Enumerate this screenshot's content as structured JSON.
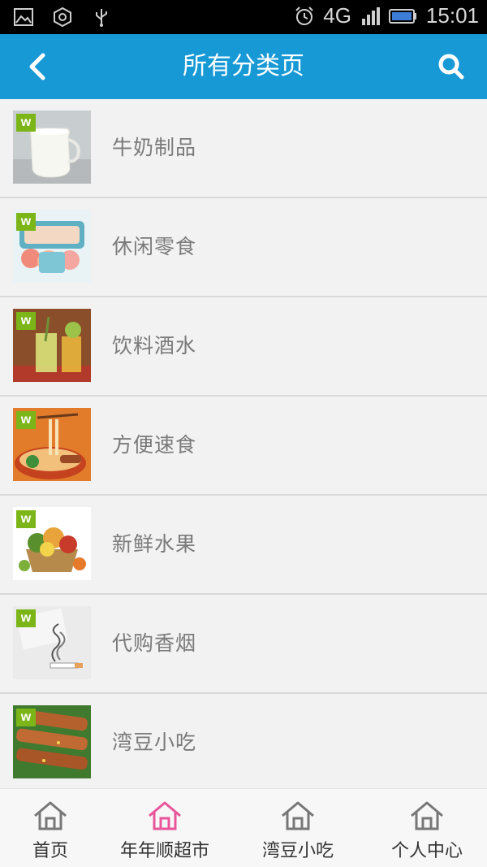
{
  "status_bar": {
    "network": "4G",
    "time": "15:01",
    "icons": [
      "image-icon",
      "settings-target-icon",
      "usb-icon",
      "alarm-icon",
      "signal-icon",
      "battery-icon"
    ]
  },
  "header": {
    "title": "所有分类页",
    "back_icon": "chevron-left-icon",
    "search_icon": "search-icon",
    "background_color": "#1799d6"
  },
  "categories": [
    {
      "label": "牛奶制品",
      "badge": "w",
      "image": "milk-image"
    },
    {
      "label": "休闲零食",
      "badge": "w",
      "image": "snacks-image"
    },
    {
      "label": "饮料酒水",
      "badge": "w",
      "image": "drinks-image"
    },
    {
      "label": "方便速食",
      "badge": "w",
      "image": "noodles-image"
    },
    {
      "label": "新鲜水果",
      "badge": "w",
      "image": "fruit-basket-image"
    },
    {
      "label": "代购香烟",
      "badge": "w",
      "image": "cigarette-image"
    },
    {
      "label": "湾豆小吃",
      "badge": "w",
      "image": "kebab-image"
    }
  ],
  "badge_color": "#7cb518",
  "bottom_nav": {
    "items": [
      {
        "label": "首页",
        "icon": "home-icon",
        "active": false
      },
      {
        "label": "年年顺超市",
        "icon": "home-icon",
        "active": true
      },
      {
        "label": "湾豆小吃",
        "icon": "home-icon",
        "active": false
      },
      {
        "label": "个人中心",
        "icon": "home-icon",
        "active": false
      }
    ],
    "active_color": "#e8559b",
    "inactive_color": "#777777"
  }
}
